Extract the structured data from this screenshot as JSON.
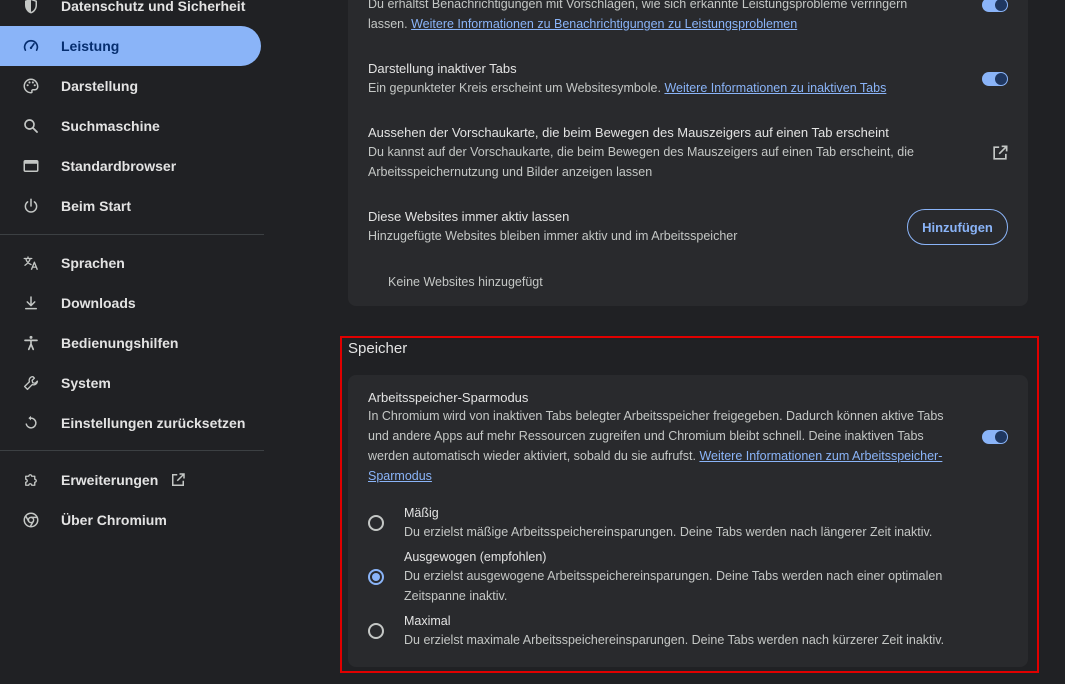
{
  "sidebar": {
    "items": [
      {
        "label": "Datenschutz und Sicherheit",
        "icon": "shield-icon"
      },
      {
        "label": "Leistung",
        "icon": "speedometer-icon",
        "active": true
      },
      {
        "label": "Darstellung",
        "icon": "palette-icon"
      },
      {
        "label": "Suchmaschine",
        "icon": "search-icon"
      },
      {
        "label": "Standardbrowser",
        "icon": "browser-window-icon"
      },
      {
        "label": "Beim Start",
        "icon": "power-icon"
      },
      {
        "label": "Sprachen",
        "icon": "translate-icon"
      },
      {
        "label": "Downloads",
        "icon": "download-icon"
      },
      {
        "label": "Bedienungshilfen",
        "icon": "accessibility-icon"
      },
      {
        "label": "System",
        "icon": "wrench-icon"
      },
      {
        "label": "Einstellungen zurücksetzen",
        "icon": "reset-icon"
      },
      {
        "label": "Erweiterungen",
        "icon": "puzzle-icon"
      },
      {
        "label": "Über Chromium",
        "icon": "chromium-icon"
      }
    ]
  },
  "performance_card": {
    "notifications": {
      "desc_text": "Du erhältst Benachrichtigungen mit Vorschlägen, wie sich erkannte Leistungsprobleme verringern lassen.",
      "link": "Weitere Informationen zu Benachrichtigungen zu Leistungsproblemen",
      "enabled": true
    },
    "inactive_tabs": {
      "title": "Darstellung inaktiver Tabs",
      "desc_text": "Ein gepunkteter Kreis erscheint um Websitesymbole.",
      "link": "Weitere Informationen zu inaktiven Tabs",
      "enabled": true
    },
    "hover_card": {
      "title": "Aussehen der Vorschaukarte, die beim Bewegen des Mauszeigers auf einen Tab erscheint",
      "desc": "Du kannst auf der Vorschaukarte, die beim Bewegen des Mauszeigers auf einen Tab erscheint, die Arbeitsspeichernutzung und Bilder anzeigen lassen"
    },
    "always_active": {
      "title": "Diese Websites immer aktiv lassen",
      "desc": "Hinzugefügte Websites bleiben immer aktiv und im Arbeitsspeicher",
      "button": "Hinzufügen",
      "empty": "Keine Websites hinzugefügt"
    }
  },
  "memory_section": {
    "title": "Speicher",
    "saver": {
      "title": "Arbeitsspeicher-Sparmodus",
      "desc_text": "In Chromium wird von inaktiven Tabs belegter Arbeitsspeicher freigegeben. Dadurch können aktive Tabs und andere Apps auf mehr Ressourcen zugreifen und Chromium bleibt schnell. Deine inaktiven Tabs werden automatisch wieder aktiviert, sobald du sie aufrufst.",
      "link": "Weitere Informationen zum Arbeitsspeicher-Sparmodus",
      "enabled": true
    },
    "options": [
      {
        "title": "Mäßig",
        "desc": "Du erzielst mäßige Arbeitsspeichereinsparungen. Deine Tabs werden nach längerer Zeit inaktiv.",
        "checked": false
      },
      {
        "title": "Ausgewogen (empfohlen)",
        "desc": "Du erzielst ausgewogene Arbeitsspeichereinsparungen. Deine Tabs werden nach einer optimalen Zeitspanne inaktiv.",
        "checked": true
      },
      {
        "title": "Maximal",
        "desc": "Du erzielst maximale Arbeitsspeichereinsparungen. Deine Tabs werden nach kürzerer Zeit inaktiv.",
        "checked": false
      }
    ]
  },
  "colors": {
    "background": "#202124",
    "card": "#292a2d",
    "accent": "#8ab4f8",
    "highlight_border": "#e00000"
  }
}
